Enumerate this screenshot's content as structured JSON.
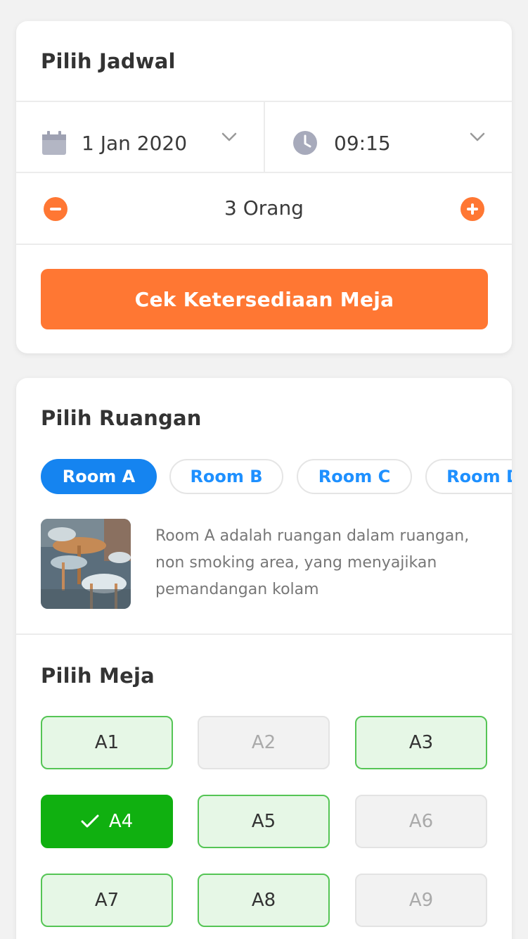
{
  "schedule": {
    "title": "Pilih Jadwal",
    "date": "1 Jan 2020",
    "time": "09:15",
    "guests": "3 Orang",
    "cta_label": "Cek Ketersediaan Meja",
    "accent_color": "#ff7733",
    "icons": {
      "date": "calendar-icon",
      "time": "clock-icon",
      "minus": "minus-circle-icon",
      "plus": "plus-circle-icon",
      "dropdown": "chevron-down-icon"
    }
  },
  "rooms": {
    "title": "Pilih Ruangan",
    "tabs": [
      {
        "label": "Room A",
        "active": true
      },
      {
        "label": "Room B",
        "active": false
      },
      {
        "label": "Room C",
        "active": false
      },
      {
        "label": "Room D",
        "active": false
      }
    ],
    "description": "Room A adalah ruangan dalam ruangan, non smoking area, yang menyajikan pemandangan kolam",
    "active_color": "#1584f0"
  },
  "tables": {
    "title": "Pilih Meja",
    "items": [
      {
        "label": "A1",
        "status": "available"
      },
      {
        "label": "A2",
        "status": "unavailable"
      },
      {
        "label": "A3",
        "status": "available"
      },
      {
        "label": "A4",
        "status": "selected"
      },
      {
        "label": "A5",
        "status": "available"
      },
      {
        "label": "A6",
        "status": "unavailable"
      },
      {
        "label": "A7",
        "status": "available"
      },
      {
        "label": "A8",
        "status": "available"
      },
      {
        "label": "A9",
        "status": "unavailable"
      }
    ],
    "colors": {
      "available": "#55c555",
      "selected": "#10b010",
      "unavailable": "#e3e3e3"
    }
  }
}
